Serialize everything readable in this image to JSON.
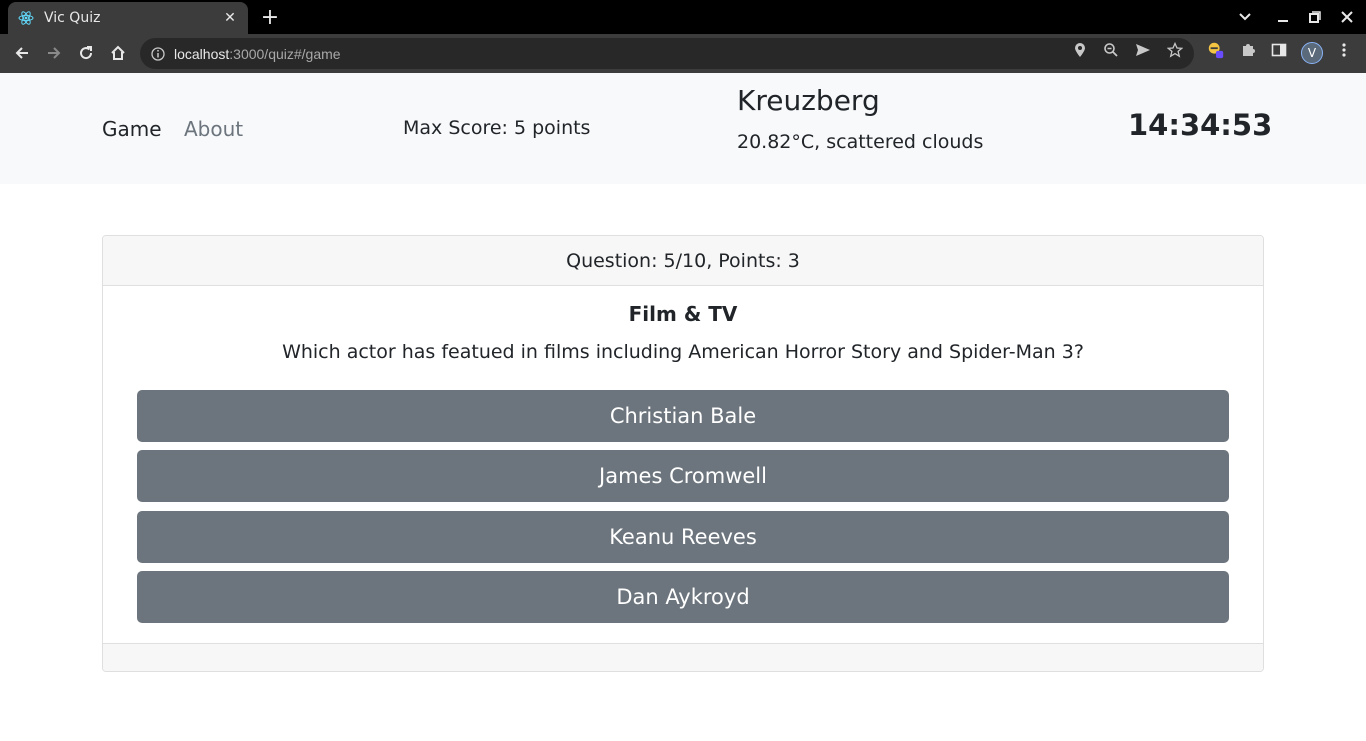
{
  "browser": {
    "tab_title": "Vic Quiz",
    "url_host": "localhost",
    "url_rest": ":3000/quiz#/game",
    "profile_initial": "V"
  },
  "nav": {
    "links": [
      "Game",
      "About"
    ],
    "max_score": "Max Score: 5 points"
  },
  "weather": {
    "city": "Kreuzberg",
    "summary": "20.82°C, scattered clouds"
  },
  "clock": "14:34:53",
  "quiz": {
    "header": "Question: 5/10, Points: 3",
    "category": "Film & TV",
    "question": "Which actor has featued in films including American Horror Story and Spider-Man 3?",
    "answers": [
      "Christian Bale",
      "James Cromwell",
      "Keanu Reeves",
      "Dan Aykroyd"
    ]
  },
  "colors": {
    "answer_button": "#6c757d",
    "navbar_bg": "#f8f9fa"
  }
}
